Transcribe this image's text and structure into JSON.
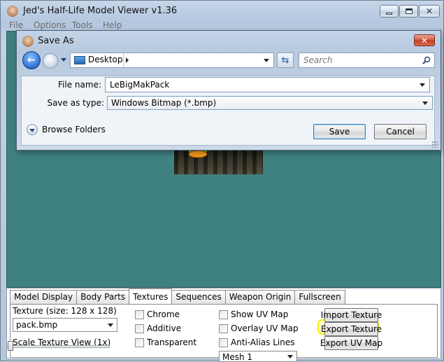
{
  "app": {
    "title": "Jed's Half-Life Model Viewer v1.36",
    "menu": [
      "File",
      "Options",
      "Tools",
      "Help"
    ]
  },
  "dialog": {
    "title": "Save As",
    "location": "Desktop",
    "search_placeholder": "Search",
    "file_name_label": "File name:",
    "file_name_value": "LeBigMakPack",
    "save_type_label": "Save as type:",
    "save_type_value": "Windows Bitmap (*.bmp)",
    "browse_folders": "Browse Folders",
    "save_button": "Save",
    "cancel_button": "Cancel"
  },
  "panel": {
    "tabs": [
      "Model Display",
      "Body Parts",
      "Textures",
      "Sequences",
      "Weapon Origin",
      "Fullscreen"
    ],
    "active_tab": "Textures",
    "texture_label": "Texture (size: 128 x 128)",
    "texture_selected": "pack.bmp",
    "scale_label": "Scale Texture View (1x)",
    "checkboxes_col1": [
      "Chrome",
      "Additive",
      "Transparent"
    ],
    "checkboxes_col2": [
      "Show UV Map",
      "Overlay UV Map",
      "Anti-Alias Lines"
    ],
    "mesh_selected": "Mesh 1",
    "buttons": [
      "Import Texture",
      "Export Texture",
      "Export UV Map"
    ],
    "highlighted_button": "Export Texture"
  },
  "colors": {
    "viewport_bg": "#3f8080",
    "highlight": "#f4ee00",
    "close_button": "#c13a20"
  },
  "icons": [
    "app-icon",
    "minimize-icon",
    "maximize-icon",
    "close-icon",
    "back-arrow-icon",
    "forward-arrow-icon",
    "desktop-icon",
    "refresh-icon",
    "search-icon",
    "chevron-down-icon",
    "resize-grip-icon"
  ]
}
